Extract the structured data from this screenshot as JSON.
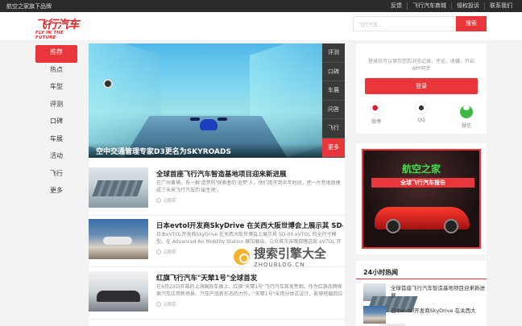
{
  "topbar": {
    "brand": "航空之家旗下品牌",
    "links": [
      "反馈",
      "飞行汽车商城",
      "侵权投诉",
      "联系我们"
    ]
  },
  "header": {
    "logo_cn": "飞行汽车",
    "logo_en": "FLY IN THE FUTURE",
    "search_placeholder": "飞行汽车...",
    "search_button": "搜索"
  },
  "leftnav": {
    "items": [
      "推荐",
      "热点",
      "车型",
      "评测",
      "口碑",
      "车展",
      "活动",
      "飞行",
      "更多"
    ]
  },
  "hero": {
    "caption": "空中交通管理专家D3更名为SKYROADS",
    "tabs": [
      "评测",
      "口碑",
      "车展",
      "问答",
      "飞行",
      "更多"
    ]
  },
  "articles": [
    {
      "title": "全球首座飞行汽车智造基地项目迎来新进展",
      "summary": "在广州黄埔，有一群'造梦的'探索者的'追梦'人，他们用不到半年时间，把一片荒地改建成了未来飞行汽车的'出生地'。",
      "time": "2周前"
    },
    {
      "title": "日本evtol开发商SkyDrive 在关西大阪世博会上展示其 SD-...",
      "summary": "日本eVTOL开发商SkyDrive 在关西大阪世博会上展示其 SD-05 eVTOL 的全尺寸模型。在 Advanced Air Mobility Station 展馆展出，公众首次亲眼目睹这款 eVTOL 开发的真实...",
      "time": "2周前"
    },
    {
      "title": "红旗飞行汽车\"天辇1号\"全球首发",
      "summary": "在4月23日开幕的上海国际车展上，红旗\"天辇1号\"飞行汽车首发亮相。作为红旗品牌探索汽车应用新场景、汽车产品新形态的力作，\"天辇1号\"采用分体式设计，能够搭载四位乘客的...",
      "time": "2周前"
    }
  ],
  "login_card": {
    "desc": "登录后可以保存您的浏览记录、评论、收藏、开启APP同步",
    "login_button": "登录",
    "social": [
      "微博",
      "QQ",
      "微信"
    ]
  },
  "ad": {
    "title": "航空之家",
    "subtitle": "全球飞行汽车报告"
  },
  "hot": {
    "title": "24小时热闻",
    "items": [
      "全球首座飞行汽车智造基地项目迎来新进展",
      "日本evtol开发商SkyDrive 在关西大"
    ]
  },
  "watermark": {
    "cn": "搜索引擎大全",
    "en": "ZHOUBLOG.CN"
  },
  "colors": {
    "accent": "#e8363b",
    "topbar": "#2b2b2b"
  }
}
